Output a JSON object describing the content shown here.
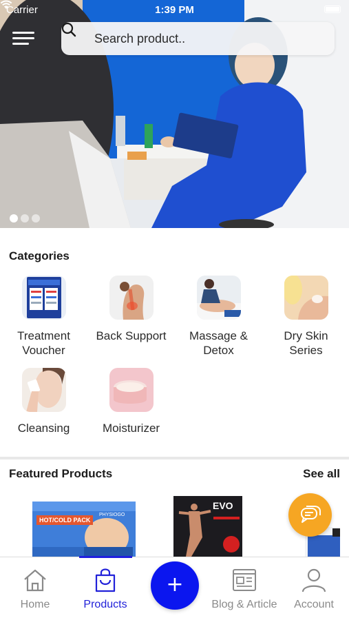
{
  "status_bar": {
    "carrier": "Carrier",
    "time": "1:39 PM"
  },
  "search": {
    "placeholder": "Search product.."
  },
  "hero": {
    "slide_count": 3,
    "active_slide": 1
  },
  "categories": {
    "title": "Categories",
    "items": [
      {
        "label": "Treatment Voucher",
        "icon": "voucher-image"
      },
      {
        "label": "Back Support",
        "icon": "back-image"
      },
      {
        "label": "Massage & Detox",
        "icon": "massage-image"
      },
      {
        "label": "Dry Skin Series",
        "icon": "dry-skin-image"
      },
      {
        "label": "Cleansing",
        "icon": "cleansing-image"
      },
      {
        "label": "Moisturizer",
        "icon": "moisturizer-image"
      }
    ]
  },
  "featured": {
    "title": "Featured Products",
    "see_all": "See all",
    "products": [
      {
        "tag": "HOT/COLD PACK",
        "brand": "PHYSIOGO"
      },
      {
        "tag": "EVO"
      }
    ]
  },
  "bottom_nav": {
    "items": [
      {
        "label": "Home",
        "icon": "home-icon"
      },
      {
        "label": "Products",
        "icon": "shopping-bag-icon",
        "active": true
      },
      {
        "label": "Blog & Article",
        "icon": "article-icon"
      },
      {
        "label": "Account",
        "icon": "user-icon"
      }
    ],
    "fab": "+"
  },
  "colors": {
    "accent": "#0b16ef",
    "active_nav": "#2121d9",
    "chat": "#f6a623",
    "uniform": "#1f4fd0"
  }
}
